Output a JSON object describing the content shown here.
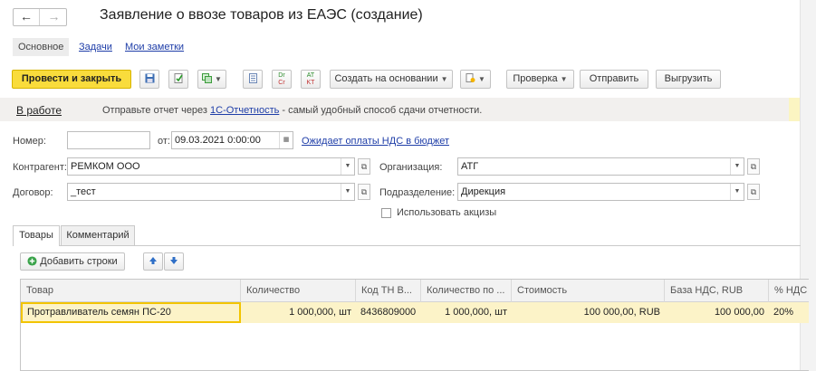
{
  "window": {
    "title": "Заявление о ввозе товаров из ЕАЭС (создание)"
  },
  "nav": {
    "back_icon": "arrow-left-icon",
    "forward_icon": "arrow-right-icon",
    "back": "←",
    "forward": "→"
  },
  "top_tabs": {
    "main": "Основное",
    "tasks": "Задачи",
    "notes": "Мои заметки"
  },
  "toolbar": {
    "post_close": "Провести и закрыть",
    "create_based": "Создать на основании",
    "check": "Проверка",
    "send": "Отправить",
    "export": "Выгрузить",
    "dt_kt_1": "Dr",
    "dt_kt_1b": "Cr",
    "dt_kt_2": "AT",
    "dt_kt_2b": "KT"
  },
  "info": {
    "status": "В работе",
    "msg_prefix": "Отправьте отчет через ",
    "msg_link": "1С-Отчетность",
    "msg_suffix": " - самый удобный способ сдачи отчетности."
  },
  "form": {
    "number_label": "Номер:",
    "number_value": "",
    "date_label": "от:",
    "date_value": "09.03.2021  0:00:00",
    "vat_link": "Ожидает оплаты НДС в бюджет",
    "counterparty_label": "Контрагент:",
    "counterparty_value": "РЕМКОМ ООО",
    "contract_label": "Договор:",
    "contract_value": "_тест",
    "org_label": "Организация:",
    "org_value": "АТГ",
    "dept_label": "Подразделение:",
    "dept_value": "Дирекция",
    "excise_label": "Использовать акцизы"
  },
  "lower_tabs": {
    "goods": "Товары",
    "comment": "Комментарий"
  },
  "table_toolbar": {
    "add_rows": "Добавить строки"
  },
  "table": {
    "headers": [
      "Товар",
      "Количество",
      "Код ТН В...",
      "Количество по ...",
      "Стоимость",
      "База НДС, RUB",
      "% НДС"
    ],
    "rows": [
      [
        "Протравливатель семян ПС-20",
        "1 000,000, шт",
        "8436809000",
        "1 000,000, шт",
        "100 000,00, RUB",
        "100 000,00",
        "20%"
      ]
    ]
  },
  "colors": {
    "primary_button": "#f9dc3c",
    "selected_row": "#fcf3c8",
    "link": "#1f3ea8"
  }
}
